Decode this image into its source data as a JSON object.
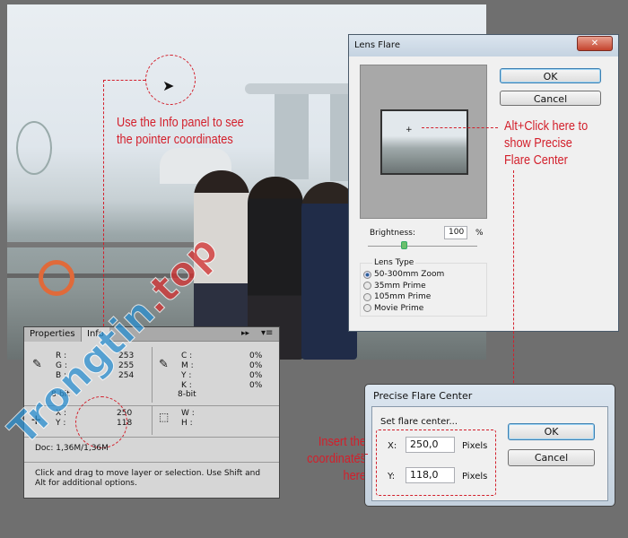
{
  "annotations": {
    "pointer_note": [
      "Use the Info panel to see",
      "the pointer coordinates"
    ],
    "alt_click_note": [
      "Alt+Click here to",
      "show Precise",
      "Flare Center"
    ],
    "insert_note": [
      "Insert the",
      "coordinates",
      "here"
    ]
  },
  "lens_flare": {
    "title": "Lens Flare",
    "ok": "OK",
    "cancel": "Cancel",
    "brightness_label": "Brightness:",
    "brightness_value": "100",
    "brightness_unit": "%",
    "brightness_percent": 100,
    "lens_type_label": "Lens Type",
    "lens_types": [
      {
        "label": "50-300mm Zoom",
        "selected": true
      },
      {
        "label": "35mm Prime",
        "selected": false
      },
      {
        "label": "105mm Prime",
        "selected": false
      },
      {
        "label": "Movie Prime",
        "selected": false
      }
    ],
    "close_icon": "close-icon"
  },
  "info_panel": {
    "tabs": [
      "Properties",
      "Info"
    ],
    "active_tab": "Info",
    "rgb": {
      "labels": [
        "R :",
        "G :",
        "B :"
      ],
      "values": [
        "253",
        "255",
        "254"
      ],
      "bit": "8-bit"
    },
    "cmyk": {
      "labels": [
        "C :",
        "M :",
        "Y :",
        "K :"
      ],
      "values": [
        "0%",
        "0%",
        "0%",
        "0%"
      ],
      "bit": "8-bit"
    },
    "xy": {
      "labels": [
        "X :",
        "Y :"
      ],
      "values": [
        "250",
        "118"
      ]
    },
    "wh": {
      "labels": [
        "W :",
        "H :"
      ]
    },
    "doc": "Doc: 1,36M/1,36M",
    "hint": "Click and drag to move layer or selection.  Use Shift and Alt for additional options."
  },
  "precise": {
    "title": "Precise Flare Center",
    "group_label": "Set flare center...",
    "x_label": "X:",
    "x_value": "250,0",
    "y_label": "Y:",
    "y_value": "118,0",
    "unit": "Pixels",
    "ok": "OK",
    "cancel": "Cancel"
  },
  "watermark": "Trongtin.top",
  "colors": {
    "annotation": "#d31f2b",
    "watermark_blue": "#2a8fd0",
    "watermark_red": "#d32f2f"
  }
}
